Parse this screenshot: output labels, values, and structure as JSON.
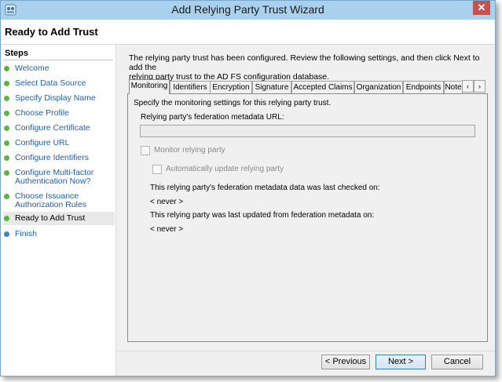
{
  "window": {
    "title": "Add Relying Party Trust Wizard",
    "close_glyph": "✕"
  },
  "header": {
    "title": "Ready to Add Trust"
  },
  "steps": {
    "title": "Steps",
    "items": [
      {
        "label": "Welcome"
      },
      {
        "label": "Select Data Source"
      },
      {
        "label": "Specify Display Name"
      },
      {
        "label": "Choose Profile"
      },
      {
        "label": "Configure Certificate"
      },
      {
        "label": "Configure URL"
      },
      {
        "label": "Configure Identifiers"
      },
      {
        "label_line1": "Configure Multi-factor",
        "label_line2": "Authentication Now?"
      },
      {
        "label_line1": "Choose Issuance",
        "label_line2": "Authorization Rules"
      },
      {
        "label": "Ready to Add Trust"
      },
      {
        "label": "Finish"
      }
    ]
  },
  "intro": {
    "line1": "The relying party trust has been configured. Review the following settings, and then click Next to add the",
    "line2": "relying party trust to the AD FS configuration database."
  },
  "tabs": {
    "items": [
      {
        "label": "Monitoring"
      },
      {
        "label": "Identifiers"
      },
      {
        "label": "Encryption"
      },
      {
        "label": "Signature"
      },
      {
        "label": "Accepted Claims"
      },
      {
        "label": "Organization"
      },
      {
        "label": "Endpoints"
      },
      {
        "label": "Note"
      }
    ],
    "scroll_left": "‹",
    "scroll_right": "›"
  },
  "monitoring": {
    "description": "Specify the monitoring settings for this relying party trust.",
    "url_label": "Relying party's federation metadata URL:",
    "url_value": "",
    "monitor_label": "Monitor relying party",
    "auto_update_label": "Automatically update relying party",
    "last_checked_label": "This relying party's federation metadata data was last checked on:",
    "last_checked_value": "< never >",
    "last_updated_label": "This relying party was last updated from federation metadata on:",
    "last_updated_value": "< never >"
  },
  "buttons": {
    "previous": "< Previous",
    "next": "Next >",
    "cancel": "Cancel"
  },
  "colors": {
    "titlebar": "#a9d1ee",
    "step_link": "#1d5fb0",
    "step_done": "#58b53e",
    "step_pending": "#3b83d6",
    "close": "#c75050"
  }
}
